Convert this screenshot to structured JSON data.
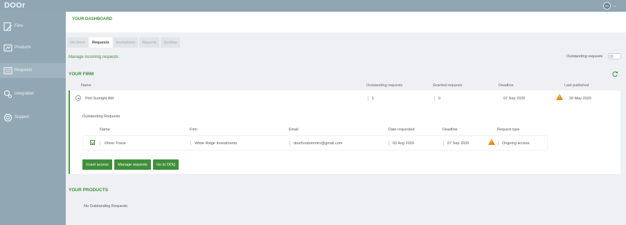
{
  "app": {
    "logo": "DOOr",
    "avatar_initials": "HC"
  },
  "sidebar": {
    "items": [
      {
        "label": "Firm",
        "icon": "firm-icon"
      },
      {
        "label": "Products",
        "icon": "products-icon"
      },
      {
        "label": "Requests",
        "icon": "requests-icon"
      },
      {
        "label": "Integration",
        "icon": "integration-icon"
      },
      {
        "label": "Support",
        "icon": "support-icon"
      }
    ],
    "active": "Requests"
  },
  "header": {
    "title": "YOUR DASHBOARD"
  },
  "tabs": [
    "On Door",
    "Requests",
    "Invitations",
    "Reports",
    "Qvidian"
  ],
  "active_tab": "Requests",
  "manage": {
    "text": "Manage incoming requests",
    "toggle_label": "Outstanding requests",
    "toggle_on": false
  },
  "your_firm": {
    "title": "YOUR FIRM",
    "columns": [
      "Name",
      "Outstanding requests",
      "Granted requests",
      "Deadline",
      "Last published"
    ],
    "row": {
      "name": "Port Sunlight AM",
      "outstanding": "1",
      "granted": "0",
      "deadline": "07 Sep 2020",
      "last_published": "20 May 2020"
    },
    "outstanding_requests": {
      "title": "Outstanding Requests",
      "columns": [
        "Name",
        "Firm",
        "Email",
        "Date requested",
        "Deadline",
        "Request type"
      ],
      "rows": [
        {
          "name": "Oliver Travis",
          "firm": "White Ridge Investments",
          "email": "doorfundsmmtrs@gmail.com",
          "date_requested": "03 Aug 2020",
          "deadline": "07 Sep 2020",
          "request_type": "Ongoing access",
          "checked": true
        }
      ]
    },
    "buttons": {
      "grant": "Grant access",
      "manage": "Manage requests",
      "ddq": "Go to DDQ"
    }
  },
  "your_products": {
    "title": "YOUR PRODUCTS",
    "empty_text": "No Outstanding Requests"
  },
  "colors": {
    "accent": "#3f8f3a",
    "sidebar": "#91a8b4",
    "warning": "#e88a1a"
  }
}
